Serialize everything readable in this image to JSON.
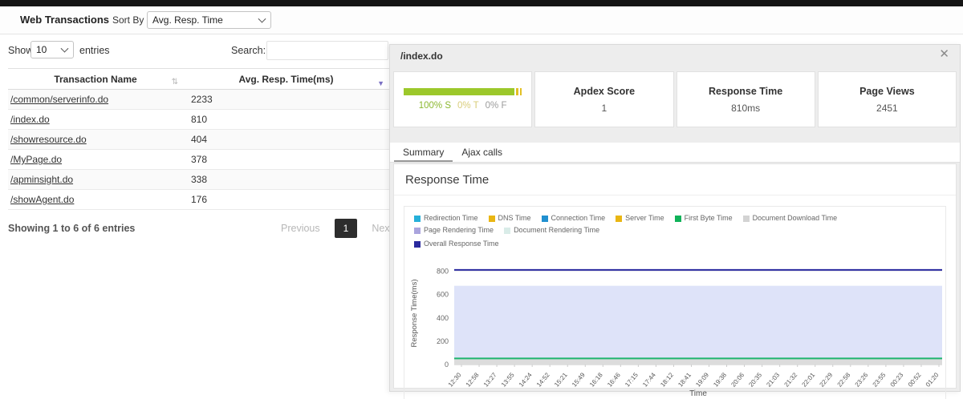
{
  "header": {
    "title": "Web Transactions",
    "sort_by_label": "Sort By :",
    "sort_by_value": "Avg. Resp. Time"
  },
  "table_controls": {
    "show_label": "Show",
    "show_value": "10",
    "entries_label": "entries",
    "search_label": "Search:",
    "search_value": ""
  },
  "table": {
    "columns": {
      "name": "Transaction Name",
      "value": "Avg. Resp. Time(ms)"
    },
    "sort_both_icon": "⇅",
    "sort_desc_icon": "▼",
    "rows": [
      {
        "name": "/common/serverinfo.do",
        "value": "2233"
      },
      {
        "name": "/index.do",
        "value": "810"
      },
      {
        "name": "/showresource.do",
        "value": "404"
      },
      {
        "name": "/MyPage.do",
        "value": "378"
      },
      {
        "name": "/apminsight.do",
        "value": "338"
      },
      {
        "name": "/showAgent.do",
        "value": "176"
      }
    ]
  },
  "table_footer": {
    "info": "Showing 1 to 6 of 6 entries",
    "pagination": {
      "previous": "Previous",
      "current": "1",
      "next": "Next"
    }
  },
  "detail_panel": {
    "title": "/index.do",
    "close_icon": "✕",
    "apdex_bar": {
      "segments": [
        {
          "color": "#9cc82b",
          "width_pct": 95.5
        },
        {
          "color": "#e2c025",
          "width_pct": 2.2
        },
        {
          "color": "#e2c025",
          "width_pct": 1.3
        }
      ],
      "caption_parts": [
        {
          "text": "100% S",
          "color": "#8cb830"
        },
        {
          "text": "0% T",
          "color": "#d9cd7a"
        },
        {
          "text": "0% F",
          "color": "#9c9c9c"
        }
      ]
    },
    "stats": [
      {
        "label": "Apdex Score",
        "value": "1"
      },
      {
        "label": "Response Time",
        "value": "810ms"
      },
      {
        "label": "Page Views",
        "value": "2451"
      }
    ],
    "tabs": [
      {
        "label": "Summary",
        "active": true
      },
      {
        "label": "Ajax calls",
        "active": false
      }
    ],
    "section_title": "Response Time"
  },
  "chart_data": {
    "type": "area",
    "title": "Response Time",
    "xlabel": "Time",
    "ylabel": "Response Time(ms)",
    "ylim": [
      0,
      880
    ],
    "yticks": [
      0,
      200,
      400,
      600,
      800
    ],
    "grid": true,
    "legend_position": "top",
    "x": [
      "12:30",
      "12:58",
      "13:27",
      "13:55",
      "14:24",
      "14:52",
      "15:21",
      "15:49",
      "16:18",
      "16:46",
      "17:15",
      "17:44",
      "18:12",
      "18:41",
      "19:09",
      "19:38",
      "20:06",
      "20:35",
      "21:03",
      "21:32",
      "22:01",
      "22:29",
      "22:58",
      "23:26",
      "23:55",
      "00:23",
      "00:52",
      "01:20"
    ],
    "legend": [
      {
        "name": "Redirection Time",
        "color": "#26b0d9"
      },
      {
        "name": "DNS Time",
        "color": "#e9b613"
      },
      {
        "name": "Connection Time",
        "color": "#2190d0"
      },
      {
        "name": "Server Time",
        "color": "#e9b613"
      },
      {
        "name": "First Byte Time",
        "color": "#10b259"
      },
      {
        "name": "Document Download Time",
        "color": "#d3d3d3"
      },
      {
        "name": "Page Rendering Time",
        "color": "#aaa4dd"
      },
      {
        "name": "Document Rendering Time",
        "color": "#d9ece8"
      },
      {
        "name": "Overall Response Time",
        "color": "#2a2a9e"
      }
    ],
    "series": [
      {
        "name": "Page Rendering Time",
        "plot": "area",
        "fill": "#dee3f9",
        "value": 676
      },
      {
        "name": "Document Download Time",
        "plot": "area",
        "fill": "#dcdcdc",
        "value": 45
      },
      {
        "name": "First Byte Time",
        "plot": "line",
        "stroke": "#1db56e",
        "value": 52
      },
      {
        "name": "Overall Response Time",
        "plot": "line",
        "stroke": "#28289e",
        "value": 812
      }
    ],
    "note": "All series are constant across every x point (flat lines)."
  }
}
